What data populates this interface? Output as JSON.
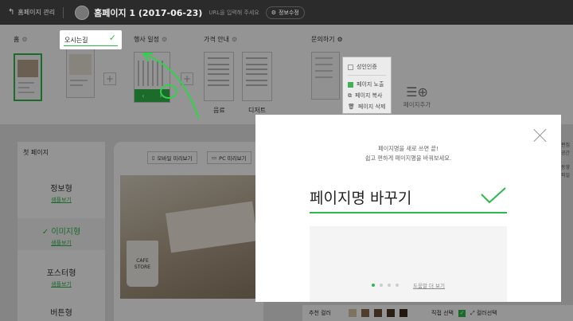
{
  "topbar": {
    "back_label": "홈페이지 관리",
    "site_title": "홈페이지 1 (2017-06-23)",
    "url_hint": "URL을 입력해 주세요",
    "edit_label": "정보수정"
  },
  "pages": [
    {
      "label": "홈"
    },
    {
      "label": "오시는길",
      "editing": true
    },
    {
      "label": "행사 일정"
    },
    {
      "label": "가격 안내",
      "subs": [
        "음료",
        "디저트"
      ]
    },
    {
      "label": "문의하기"
    }
  ],
  "context_menu": {
    "items": [
      {
        "label": "성인인증",
        "checked": false
      },
      {
        "label": "페이지 노출",
        "checked": true
      },
      {
        "label": "페이지 복사",
        "icon": "copy-icon"
      },
      {
        "label": "페이지 삭제",
        "icon": "trash-icon"
      }
    ]
  },
  "add_page_label": "페이지추가",
  "layout_panel": {
    "header": "첫 페이지",
    "items": [
      {
        "name": "정보형",
        "sub": "샘플보기",
        "active": false
      },
      {
        "name": "이미지형",
        "sub": "샘플보기",
        "active": true
      },
      {
        "name": "포스터형",
        "sub": "샘플보기",
        "active": false
      },
      {
        "name": "버튼형",
        "sub": "",
        "active": false
      }
    ]
  },
  "preview": {
    "mobile_label": "모바일 미리보기",
    "pc_label": "PC 미리보기",
    "cup_text_1": "CAFE",
    "cup_text_2": "STORE"
  },
  "modal": {
    "desc_line1": "페이지명을 새로 쓰면 끝!",
    "desc_line2": "쉽고 편하게 페이지명을 바꿔보세요.",
    "field_text": "페이지명 바꾸기",
    "more_link": "도움말 더 보기",
    "active_dot": 0,
    "dot_count": 4
  },
  "bottombar": {
    "rec_color_label": "추천 컬러",
    "manual_label": "직접 선택",
    "color_pick_label": "컬러선택",
    "swatches": [
      "#d9c4a8",
      "#8b6a4a",
      "#6b4e34",
      "#4a3624",
      "#3a2a1c"
    ]
  },
  "right_sliver": [
    "편집",
    "공간",
    "동영",
    "파일"
  ],
  "colors": {
    "accent": "#2fb84b",
    "topbar": "#2b2b2b"
  }
}
